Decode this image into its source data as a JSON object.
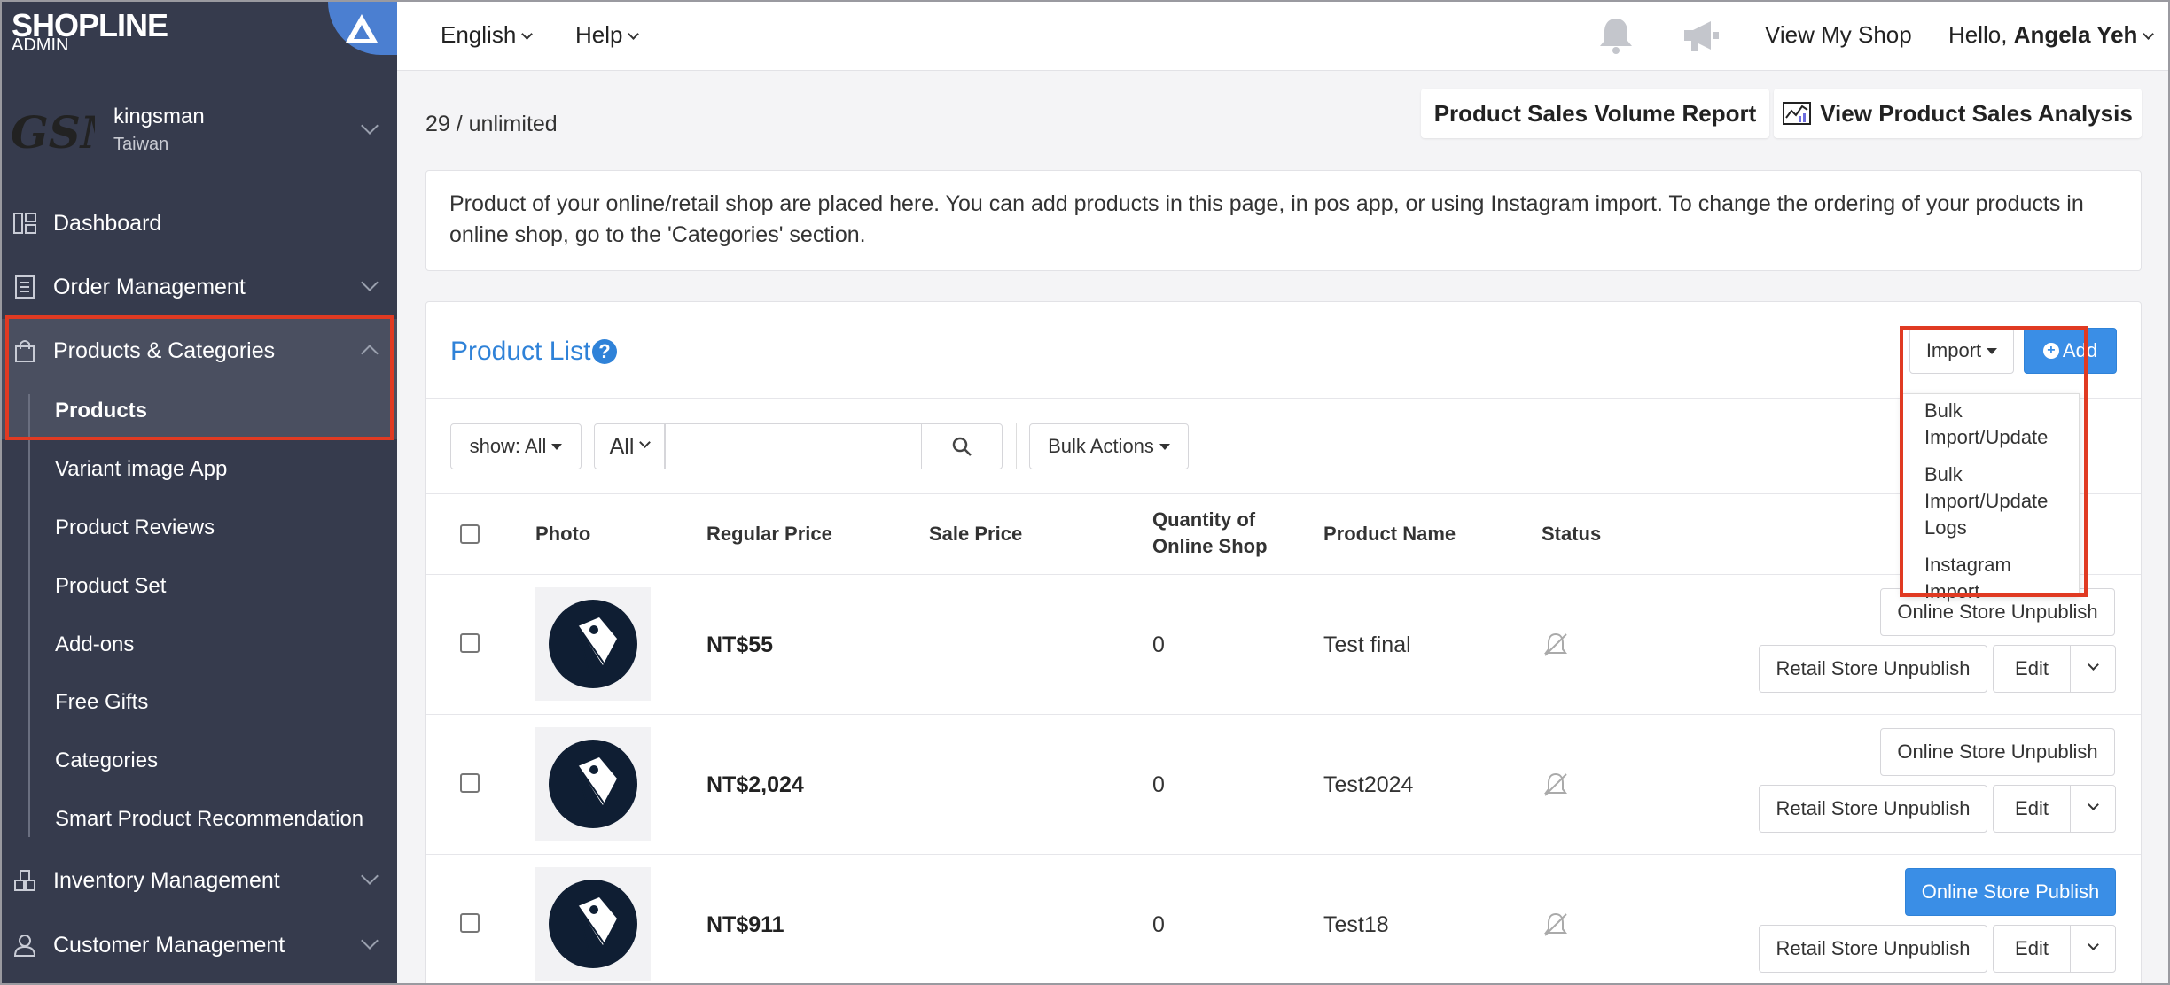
{
  "brand": {
    "logo": "SHOPLINE",
    "logo_sub": "ADMIN"
  },
  "shop": {
    "mark": "GSM",
    "name": "kingsman",
    "region": "Taiwan"
  },
  "sidebar": {
    "items": [
      {
        "label": "Dashboard",
        "icon": "dashboard-icon"
      },
      {
        "label": "Order Management",
        "icon": "order-icon"
      },
      {
        "label": "Products & Categories",
        "icon": "bag-icon"
      },
      {
        "label": "Inventory Management",
        "icon": "inventory-icon"
      },
      {
        "label": "Customer Management",
        "icon": "user-icon"
      }
    ],
    "sub_items": [
      "Products",
      "Variant image App",
      "Product Reviews",
      "Product Set",
      "Add-ons",
      "Free Gifts",
      "Categories",
      "Smart Product Recommendation"
    ]
  },
  "topbar": {
    "language": "English",
    "help": "Help",
    "view_shop": "View My Shop",
    "greeting": "Hello,",
    "user_name": "Angela Yeh"
  },
  "main": {
    "counter": "29 / unlimited",
    "sales_report_button": "Product Sales Volume Report",
    "sales_analysis_button": "View Product Sales Analysis",
    "info_text": "Product of your online/retail shop are placed here. You can add products in this page, in pos app, or using Instagram import. To change the ordering of your products in online shop, go to the 'Categories' section."
  },
  "product_list": {
    "title": "Product List",
    "import_label": "Import",
    "add_label": "Add",
    "import_menu": [
      "Bulk Import/Update",
      "Bulk Import/Update Logs",
      "Instagram Import"
    ],
    "filter_show": "show: All",
    "filter_field": "All",
    "search_value": "",
    "bulk_actions": "Bulk Actions",
    "columns": [
      "Photo",
      "Regular Price",
      "Sale Price",
      "Quantity of Online Shop",
      "Product Name",
      "Status"
    ],
    "rows": [
      {
        "regular_price": "NT$55",
        "sale_price": "",
        "quantity": "0",
        "name": "Test final",
        "online_action": "Online Store Unpublish",
        "retail_action": "Retail Store Unpublish",
        "edit": "Edit"
      },
      {
        "regular_price": "NT$2,024",
        "sale_price": "",
        "quantity": "0",
        "name": "Test2024",
        "online_action": "Online Store Unpublish",
        "retail_action": "Retail Store Unpublish",
        "edit": "Edit"
      },
      {
        "regular_price": "NT$911",
        "sale_price": "",
        "quantity": "0",
        "name": "Test18",
        "online_action": "Online Store Publish",
        "retail_action": "Retail Store Unpublish",
        "edit": "Edit"
      }
    ]
  },
  "colors": {
    "sidebar_bg": "#363b4d",
    "accent": "#3a8ee6",
    "highlight": "#e03a22"
  }
}
